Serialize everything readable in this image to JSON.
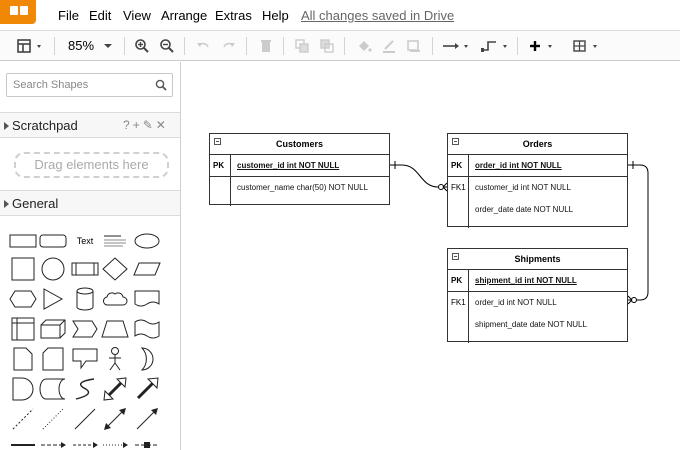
{
  "app": {
    "menu": [
      "File",
      "Edit",
      "View",
      "Arrange",
      "Extras",
      "Help"
    ],
    "save_status": "All changes saved in Drive"
  },
  "toolbar": {
    "zoom": "85%",
    "icons": [
      "format-panel-icon",
      "zoom-in-icon",
      "zoom-out-icon",
      "undo-icon",
      "redo-icon",
      "delete-icon",
      "to-front-icon",
      "to-back-icon",
      "fill-color-icon",
      "line-color-icon",
      "shadow-icon",
      "connection-icon",
      "waypoints-icon",
      "insert-icon",
      "table-icon"
    ]
  },
  "sidebar": {
    "search_placeholder": "Search Shapes",
    "scratchpad": {
      "title": "Scratchpad",
      "tools": [
        "?",
        "+",
        "✎",
        "✕"
      ],
      "drop_hint": "Drag elements here"
    },
    "general": {
      "title": "General",
      "text_shape": "Text"
    }
  },
  "diagram": {
    "tables": [
      {
        "name": "Customers",
        "pk_label": "PK",
        "pk_field": "customer_id int NOT NULL",
        "fields": [
          {
            "key": "",
            "name": "customer_name char(50) NOT NULL"
          }
        ]
      },
      {
        "name": "Orders",
        "pk_label": "PK",
        "pk_field": "order_id int NOT NULL",
        "fields": [
          {
            "key": "FK1",
            "name": "customer_id int NOT NULL"
          },
          {
            "key": "",
            "name": "order_date date NOT NULL"
          }
        ]
      },
      {
        "name": "Shipments",
        "pk_label": "PK",
        "pk_field": "shipment_id int NOT NULL",
        "fields": [
          {
            "key": "FK1",
            "name": "order_id int NOT NULL"
          },
          {
            "key": "",
            "name": "shipment_date date NOT NULL"
          }
        ]
      }
    ]
  },
  "colors": {
    "brand": "#f08705",
    "canvas_bg": "#ffffff",
    "border": "#333333"
  }
}
